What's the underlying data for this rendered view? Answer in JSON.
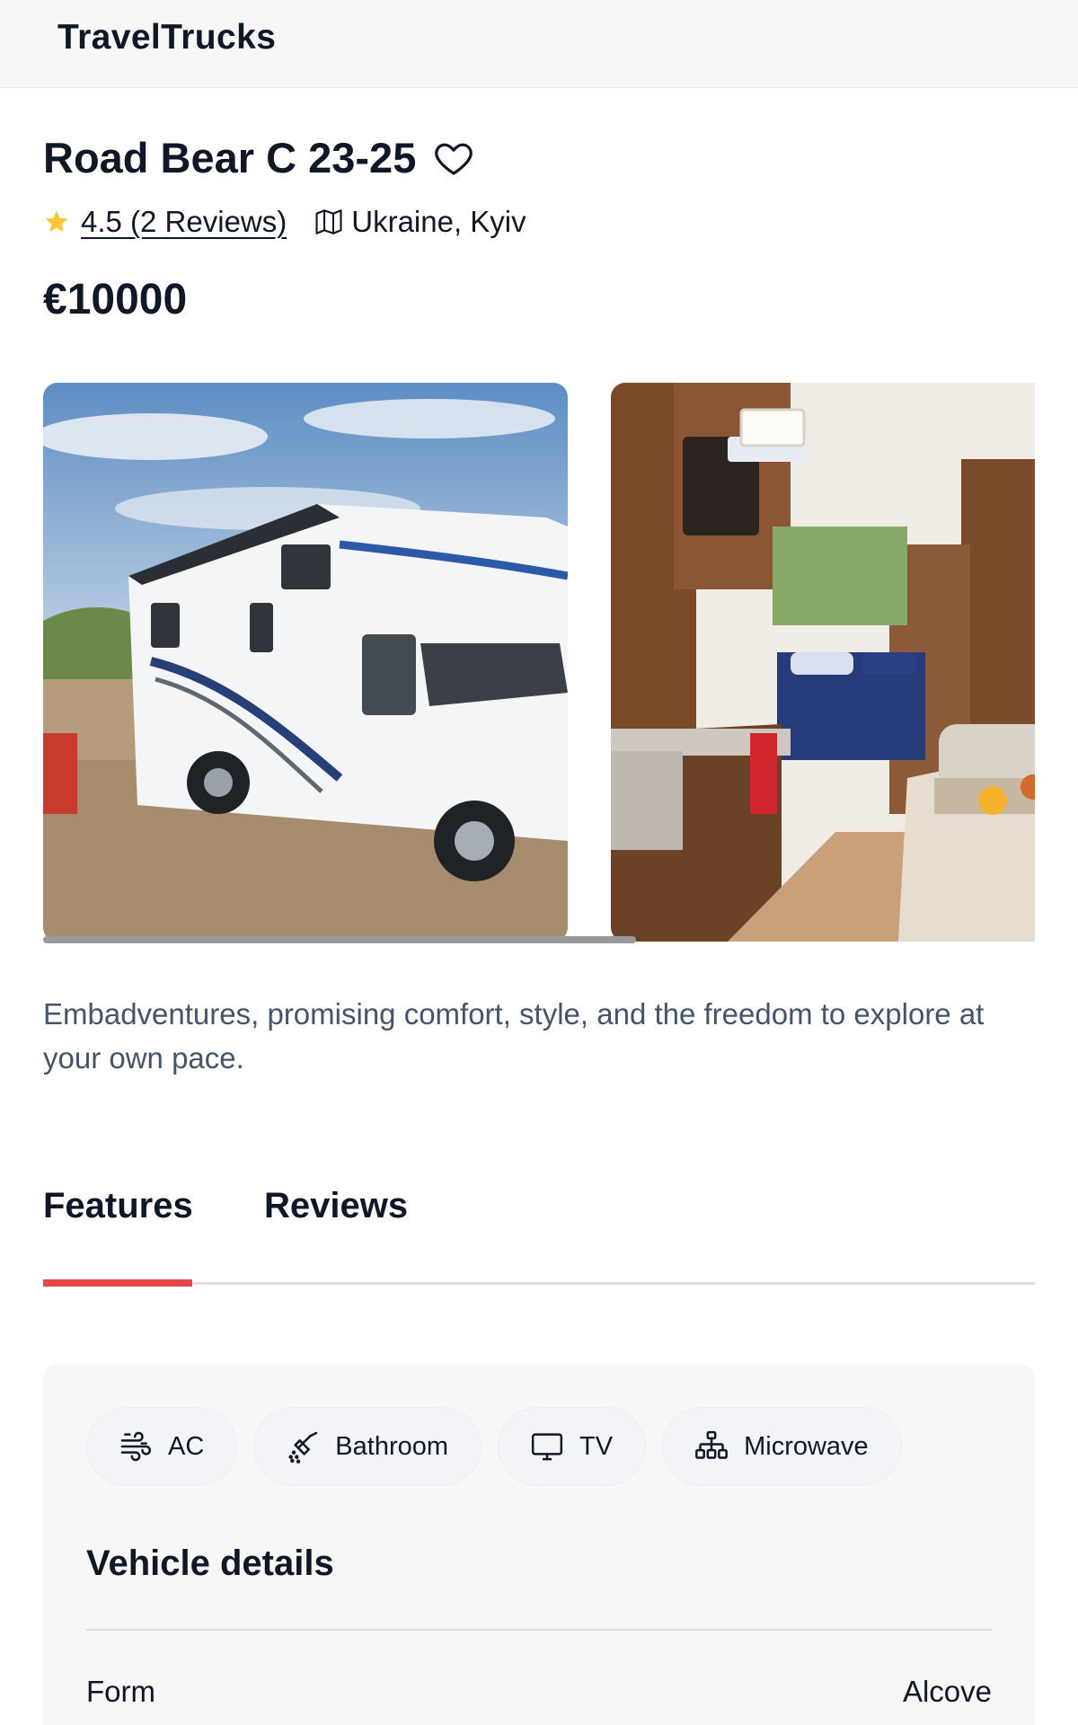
{
  "header": {
    "logo": "TravelTrucks"
  },
  "camper": {
    "name": "Road Bear C 23-25",
    "rating_text": "4.5 (2 Reviews)",
    "location": "Ukraine, Kyiv",
    "price": "€10000",
    "description": "Embadventures, promising comfort, style, and the freedom to explore at your own pace."
  },
  "tabs": [
    {
      "label": "Features",
      "active": true
    },
    {
      "label": "Reviews",
      "active": false
    }
  ],
  "features": [
    {
      "label": "AC",
      "icon": "wind-icon"
    },
    {
      "label": "Bathroom",
      "icon": "shower-icon"
    },
    {
      "label": "TV",
      "icon": "tv-icon"
    },
    {
      "label": "Microwave",
      "icon": "microwave-icon"
    }
  ],
  "vehicle_details": {
    "title": "Vehicle details",
    "rows": [
      {
        "label": "Form",
        "value": "Alcove"
      }
    ]
  },
  "colors": {
    "accent": "#e44848",
    "rating_star": "#ffc531",
    "text_main": "#101828",
    "text_muted": "#475467",
    "panel_bg": "#f7f7f7"
  }
}
